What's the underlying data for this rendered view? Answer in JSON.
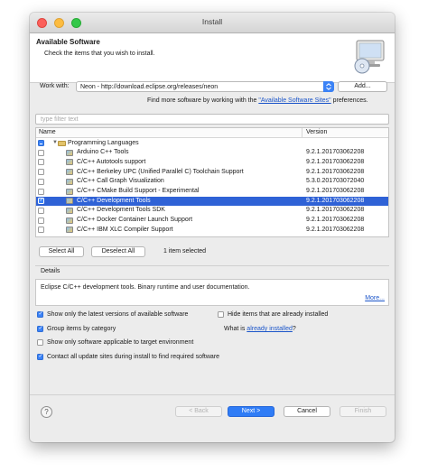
{
  "window": {
    "title": "Install"
  },
  "header": {
    "title": "Available Software",
    "description": "Check the items that you wish to install."
  },
  "work_with": {
    "label": "Work with:",
    "value": "Neon - http://download.eclipse.org/releases/neon",
    "add_label": "Add...",
    "hint_prefix": "Find more software by working with the",
    "hint_link": "\"Available Software Sites\"",
    "hint_suffix": "preferences."
  },
  "filter": {
    "placeholder": "type filter text"
  },
  "table": {
    "columns": [
      "Name",
      "Version"
    ],
    "group": {
      "label": "Programming Languages",
      "check": "partial"
    },
    "rows": [
      {
        "name": "Arduino C++ Tools",
        "version": "9.2.1.201703062208",
        "checked": false
      },
      {
        "name": "C/C++ Autotools support",
        "version": "9.2.1.201703062208",
        "checked": false
      },
      {
        "name": "C/C++ Berkeley UPC (Unified Parallel C) Toolchain Support",
        "version": "9.2.1.201703062208",
        "checked": false
      },
      {
        "name": "C/C++ Call Graph Visualization",
        "version": "5.3.0.201703072040",
        "checked": false
      },
      {
        "name": "C/C++ CMake Build Support - Experimental",
        "version": "9.2.1.201703062208",
        "checked": false
      },
      {
        "name": "C/C++ Development Tools",
        "version": "9.2.1.201703062208",
        "checked": true,
        "selected": true
      },
      {
        "name": "C/C++ Development Tools SDK",
        "version": "9.2.1.201703062208",
        "checked": false
      },
      {
        "name": "C/C++ Docker Container Launch Support",
        "version": "9.2.1.201703062208",
        "checked": false
      },
      {
        "name": "C/C++ IBM XLC Compiler Support",
        "version": "9.2.1.201703062208",
        "checked": false
      }
    ]
  },
  "selection": {
    "select_all": "Select All",
    "deselect_all": "Deselect All",
    "status": "1 item selected"
  },
  "details": {
    "label": "Details",
    "text": "Eclipse C/C++ development tools. Binary runtime and user documentation.",
    "more": "More..."
  },
  "options": {
    "latest_only": {
      "label": "Show only the latest versions of available software",
      "checked": true
    },
    "hide_installed": {
      "label": "Hide items that are already installed",
      "checked": false
    },
    "group_by_category": {
      "label": "Group items by category",
      "checked": true
    },
    "what_is_prefix": "What is",
    "already_installed_link": "already installed",
    "what_is_suffix": "?",
    "target_env": {
      "label": "Show only software applicable to target environment",
      "checked": false
    },
    "contact_sites": {
      "label": "Contact all update sites during install to find required software",
      "checked": true
    }
  },
  "footer": {
    "help": "?",
    "back": "< Back",
    "next": "Next >",
    "cancel": "Cancel",
    "finish": "Finish"
  },
  "colors": {
    "accent": "#3b82f6",
    "selection": "#2f62d6",
    "link": "#1b55c9"
  }
}
